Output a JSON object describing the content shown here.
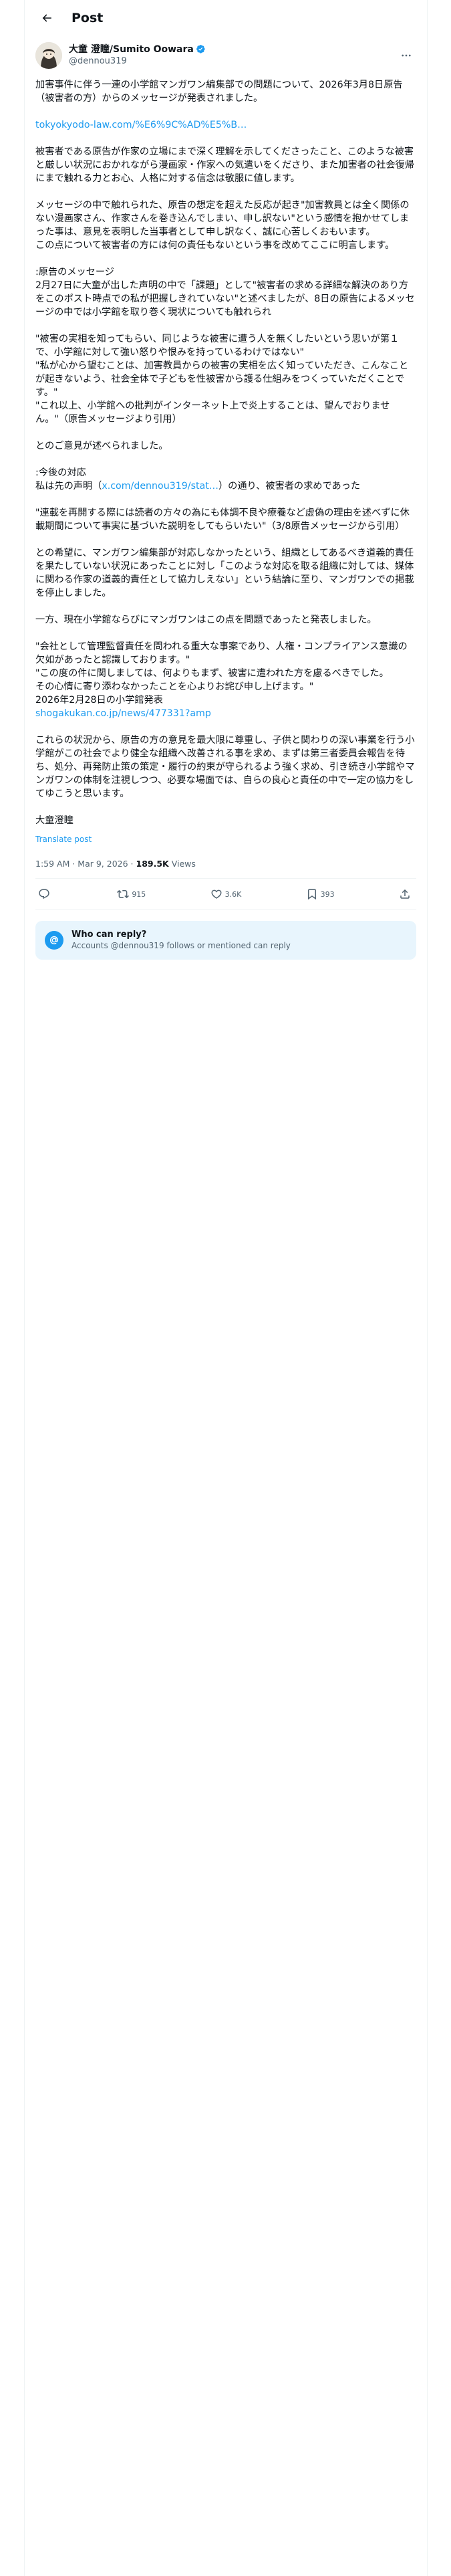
{
  "header": {
    "title": "Post"
  },
  "author": {
    "name": "大童 澄瞳/Sumito Oowara",
    "handle": "@dennou319"
  },
  "tweet": {
    "p1": "加害事件に伴う一連の小学館マンガワン編集部での問題について、2026年3月8日原告（被害者の方）からのメッセージが発表されました。",
    "link1": "tokyokyodo-law.com/%E6%9C%AD%E5%B…",
    "p2": "被害者である原告が作家の立場にまで深く理解を示してくださったこと、このような被害と厳しい状況におかれながら漫画家・作家への気遣いをくださり、また加害者の社会復帰にまで触れる力とお心、人格に対する信念は敬服に値します。",
    "p3": "メッセージの中で触れられた、原告の想定を超えた反応が起き\"加害教員とは全く関係のない漫画家さん、作家さんを巻き込んでしまい、申し訳ない\"という感情を抱かせてしまった事は、意見を表明した当事者として申し訳なく、誠に心苦しくおもいます。\nこの点について被害者の方には何の責任もないという事を改めてここに明言します。",
    "p4": ":原告のメッセージ\n2月27日に大童が出した声明の中で「課題」として\"被害者の求める詳細な解決のあり方をこのポスト時点での私が把握しきれていない\"と述べましたが、8日の原告によるメッセージの中では小学館を取り巻く現状についても触れられ",
    "p5": "\"被害の実相を知ってもらい、同じような被害に遭う人を無くしたいという思いが第１で、小学館に対して強い怒りや恨みを持っているわけではない\"\n\"私が心から望むことは、加害教員からの被害の実相を広く知っていただき、こんなことが起きないよう、社会全体で子どもを性被害から護る仕組みをつくっていただくことです。\"\n\"これ以上、小学館への批判がインターネット上で炎上することは、望んでおりません。\"（原告メッセージより引用）",
    "p6": "とのご意見が述べられました。",
    "p7a": ":今後の対応\n私は先の声明（",
    "link2": "x.com/dennou319/stat…",
    "p7b": "）の通り、被害者の求めであった",
    "p8": "\"連載を再開する際には読者の方々の為にも体調不良や療養など虚偽の理由を述べずに休載期間について事実に基づいた説明をしてもらいたい\"（3/8原告メッセージから引用）",
    "p9": "との希望に、マンガワン編集部が対応しなかったという、組織としてあるべき道義的責任を果たしていない状況にあったことに対し「このような対応を取る組織に対しては、媒体に関わる作家の道義的責任として協力しえない」という結論に至り、マンガワンでの掲載を停止しました。",
    "p10": "一方、現在小学館ならびにマンガワンはこの点を問題であったと発表しました。",
    "p11": "\"会社として管理監督責任を問われる重大な事案であり、人権・コンプライアンス意識の欠如があったと認識しております。\"\n\"この度の件に関しましては、何よりもまず、被害に遭われた方を慮るべきでした。\nその心情に寄り添わなかったことを心よりお詫び申し上げます。\"\n2026年2月28日の小学館発表",
    "link3": "shogakukan.co.jp/news/477331?amp",
    "p12": "これらの状況から、原告の方の意見を最大限に尊重し、子供と関わりの深い事業を行う小学館がこの社会でより健全な組織へ改善される事を求め、まずは第三者委員会報告を待ち、処分、再発防止策の策定・履行の約束が守られるよう強く求め、引き続き小学館やマンガワンの体制を注視しつつ、必要な場面では、自らの良心と責任の中で一定の協力をしてゆこうと思います。",
    "p13": "大童澄瞳",
    "translate": "Translate post"
  },
  "meta": {
    "time": "1:59 AM · Mar 9, 2026",
    "separator": " · ",
    "views": "189.5K",
    "views_label": " Views"
  },
  "actions": {
    "reply_count": "",
    "retweet_count": "915",
    "like_count": "3.6K",
    "bookmark_count": "393"
  },
  "reply_card": {
    "title": "Who can reply?",
    "subtitle": "Accounts @dennou319 follows or mentioned can reply"
  },
  "colors": {
    "accent": "#1d9bf0",
    "text": "#0f1419",
    "secondary": "#536471",
    "reply_card_bg": "#e8f5fd"
  },
  "icons": [
    "back-arrow-icon",
    "verified-badge-icon",
    "more-icon",
    "reply-icon",
    "retweet-icon",
    "like-icon",
    "bookmark-icon",
    "share-icon",
    "at-sign-icon"
  ]
}
